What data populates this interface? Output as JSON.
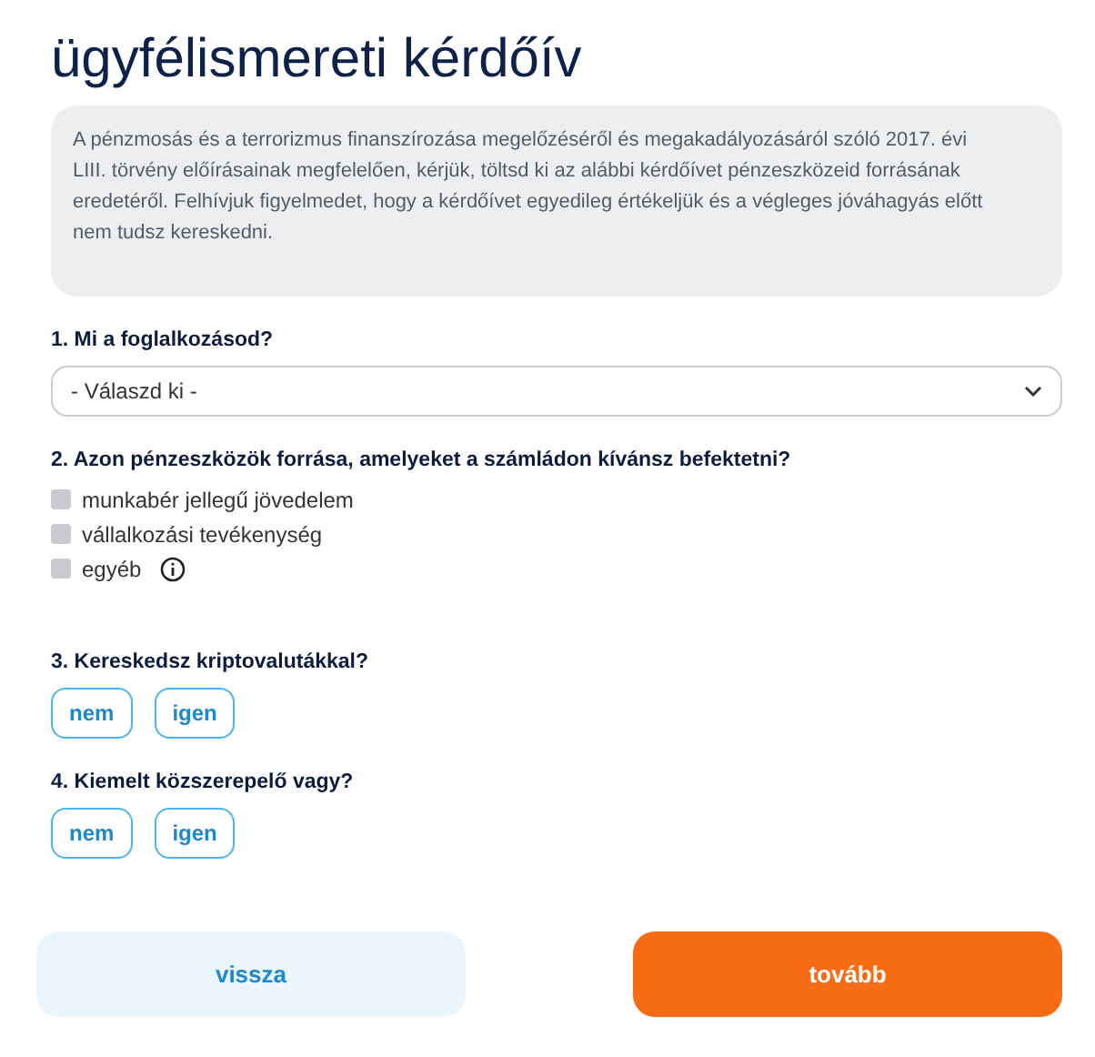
{
  "title": "ügyfélismereti kérdőív",
  "notice": "A pénzmosás és a terrorizmus finanszírozása megelőzéséről és megakadályozásáról szóló 2017. évi LIII. törvény előírásainak megfelelően, kérjük, töltsd ki az alábbi kérdőívet pénzeszközeid forrásának eredetéről. Felhívjuk figyelmedet, hogy a kérdőívet egyedileg értékeljük és a végleges jóváhagyás előtt nem tudsz kereskedni.",
  "questions": [
    {
      "kind": "select",
      "label": "1. Mi a foglalkozásod?",
      "placeholder": "- Válaszd ki -"
    },
    {
      "kind": "checkbox",
      "label": "2. Azon pénzeszközök forrása, amelyeket a számládon kívánsz befektetni?",
      "options": [
        {
          "label": "munkabér jellegű jövedelem",
          "checked": false,
          "info": false
        },
        {
          "label": "vállalkozási tevékenység",
          "checked": false,
          "info": false
        },
        {
          "label": "egyéb",
          "checked": false,
          "info": true
        }
      ]
    },
    {
      "kind": "choice",
      "label": "3. Kereskedsz kriptovalutákkal?",
      "options": [
        {
          "label": "nem",
          "selected": false
        },
        {
          "label": "igen",
          "selected": false
        }
      ]
    },
    {
      "kind": "choice",
      "label": "4. Kiemelt közszerepelő vagy?",
      "options": [
        {
          "label": "nem",
          "selected": false
        },
        {
          "label": "igen",
          "selected": false
        }
      ]
    }
  ],
  "buttons": {
    "back": "vissza",
    "next": "tovább"
  }
}
